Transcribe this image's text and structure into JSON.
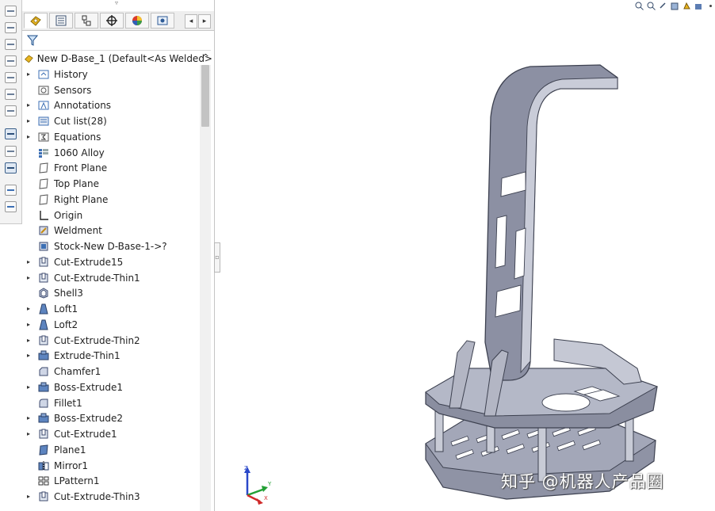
{
  "feature_tree": {
    "root": {
      "label": "New D-Base_1 (Default<As Welded>",
      "icon": "part-icon"
    },
    "items": [
      {
        "label": "History",
        "icon": "history-folder-icon",
        "expandable": true
      },
      {
        "label": "Sensors",
        "icon": "sensor-icon",
        "expandable": false
      },
      {
        "label": "Annotations",
        "icon": "annotation-icon",
        "expandable": true
      },
      {
        "label": "Cut list(28)",
        "icon": "cut-list-icon",
        "expandable": true
      },
      {
        "label": "Equations",
        "icon": "equation-icon",
        "expandable": true
      },
      {
        "label": "1060 Alloy",
        "icon": "material-icon",
        "expandable": false
      },
      {
        "label": "Front Plane",
        "icon": "plane-icon",
        "expandable": false
      },
      {
        "label": "Top Plane",
        "icon": "plane-icon",
        "expandable": false
      },
      {
        "label": "Right Plane",
        "icon": "plane-icon",
        "expandable": false
      },
      {
        "label": "Origin",
        "icon": "origin-icon",
        "expandable": false
      },
      {
        "label": "Weldment",
        "icon": "weldment-icon",
        "expandable": false
      },
      {
        "label": "Stock-New D-Base-1->?",
        "icon": "stock-icon",
        "expandable": false
      },
      {
        "label": "Cut-Extrude15",
        "icon": "cut-extrude-icon",
        "expandable": true
      },
      {
        "label": "Cut-Extrude-Thin1",
        "icon": "cut-extrude-icon",
        "expandable": true
      },
      {
        "label": "Shell3",
        "icon": "shell-icon",
        "expandable": false
      },
      {
        "label": "Loft1",
        "icon": "loft-icon",
        "expandable": true
      },
      {
        "label": "Loft2",
        "icon": "loft-icon",
        "expandable": true
      },
      {
        "label": "Cut-Extrude-Thin2",
        "icon": "cut-extrude-icon",
        "expandable": true
      },
      {
        "label": "Extrude-Thin1",
        "icon": "extrude-icon",
        "expandable": true
      },
      {
        "label": "Chamfer1",
        "icon": "chamfer-icon",
        "expandable": false
      },
      {
        "label": "Boss-Extrude1",
        "icon": "extrude-icon",
        "expandable": true
      },
      {
        "label": "Fillet1",
        "icon": "fillet-icon",
        "expandable": false
      },
      {
        "label": "Boss-Extrude2",
        "icon": "extrude-icon",
        "expandable": true
      },
      {
        "label": "Cut-Extrude1",
        "icon": "cut-extrude-icon",
        "expandable": true
      },
      {
        "label": "Plane1",
        "icon": "plane-feature-icon",
        "expandable": false
      },
      {
        "label": "Mirror1",
        "icon": "mirror-icon",
        "expandable": false
      },
      {
        "label": "LPattern1",
        "icon": "linear-pattern-icon",
        "expandable": false
      },
      {
        "label": "Cut-Extrude-Thin3",
        "icon": "cut-extrude-icon",
        "expandable": true
      }
    ]
  },
  "manager_tabs": [
    {
      "name": "featuremanager-tab",
      "icon": "feature-manager-icon",
      "active": true
    },
    {
      "name": "propertymanager-tab",
      "icon": "property-manager-icon",
      "active": false
    },
    {
      "name": "configurationmanager-tab",
      "icon": "configuration-manager-icon",
      "active": false
    },
    {
      "name": "dimxpert-tab",
      "icon": "dimxpert-icon",
      "active": false
    },
    {
      "name": "display-manager-tab",
      "icon": "display-manager-icon",
      "active": false
    },
    {
      "name": "cam-tab",
      "icon": "cam-icon",
      "active": false
    }
  ],
  "triad_axes": {
    "x": "X",
    "y": "Y",
    "z": "Z"
  },
  "watermark": "知乎 @机器人产品圈",
  "colors": {
    "part_fill": "#9ea2b4",
    "part_dark": "#5f6374",
    "part_light": "#d8dae3",
    "accent_yellow": "#e9b520",
    "tree_icon_blue": "#3c6fb4"
  }
}
